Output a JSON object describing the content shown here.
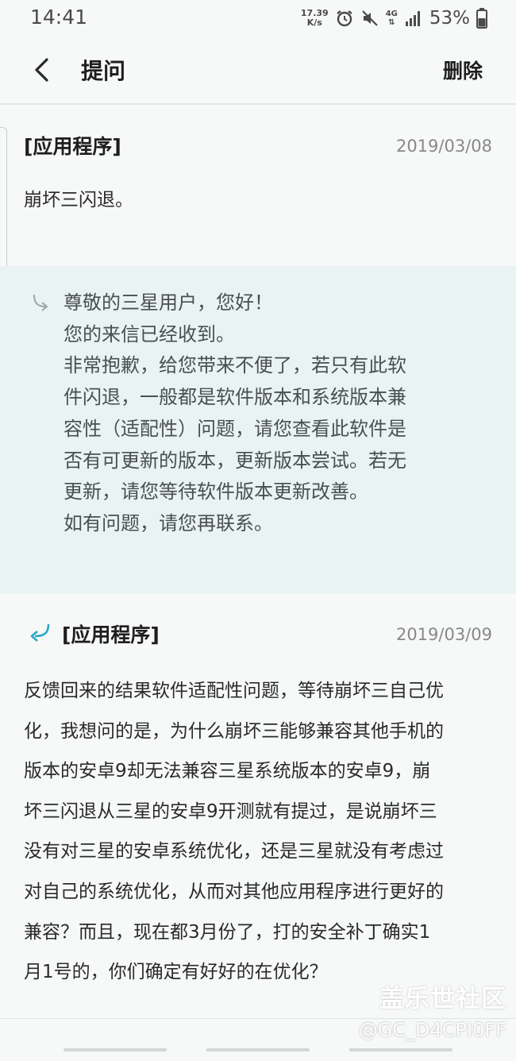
{
  "status_bar": {
    "time": "14:41",
    "net_speed_value": "17.39",
    "net_speed_unit": "K/s",
    "network_type": "4G",
    "battery": "53%",
    "icons": [
      "alarm-icon",
      "mute-icon",
      "signal-icon",
      "battery-icon"
    ]
  },
  "header": {
    "back_icon": "chevron-left-icon",
    "title": "提问",
    "delete_label": "删除"
  },
  "question": {
    "category": "[应用程序]",
    "date": "2019/03/08",
    "content": "崩坏三闪退。"
  },
  "reply": {
    "icon": "reply-arrow-icon",
    "lines": [
      "尊敬的三星用户，您好！",
      "您的来信已经收到。",
      "非常抱歉，给您带来不便了，若只有此软",
      "件闪退，一般都是软件版本和系统版本兼",
      "容性（适配性）问题，请您查看此软件是",
      "否有可更新的版本，更新版本尝试。若无",
      "更新，请您等待软件版本更新改善。",
      "如有问题，请您再联系。"
    ]
  },
  "followup": {
    "icon": "followup-arrow-icon",
    "category": "[应用程序]",
    "date": "2019/03/09",
    "lines": [
      "反馈回来的结果软件适配性问题，等待崩坏三自己优",
      "化，我想问的是，为什么崩坏三能够兼容其他手机的",
      "版本的安卓9却无法兼容三星系统版本的安卓9，崩",
      "坏三闪退从三星的安卓9开测就有提过，是说崩坏三",
      "没有对三星的安卓系统优化，还是三星就没有考虑过",
      "对自己的系统优化，从而对其他应用程序进行更好的",
      "兼容？而且，现在都3月份了，打的安全补丁确实1",
      "月1号的，你们确定有好好的在优化？"
    ]
  },
  "watermark": {
    "title": "盖乐世社区",
    "handle": "@GC_D4CPI0FF"
  },
  "colors": {
    "reply_background": "#e9f3f4",
    "accent_teal": "#2aa7c4",
    "page_background": "#f7f8f8"
  }
}
